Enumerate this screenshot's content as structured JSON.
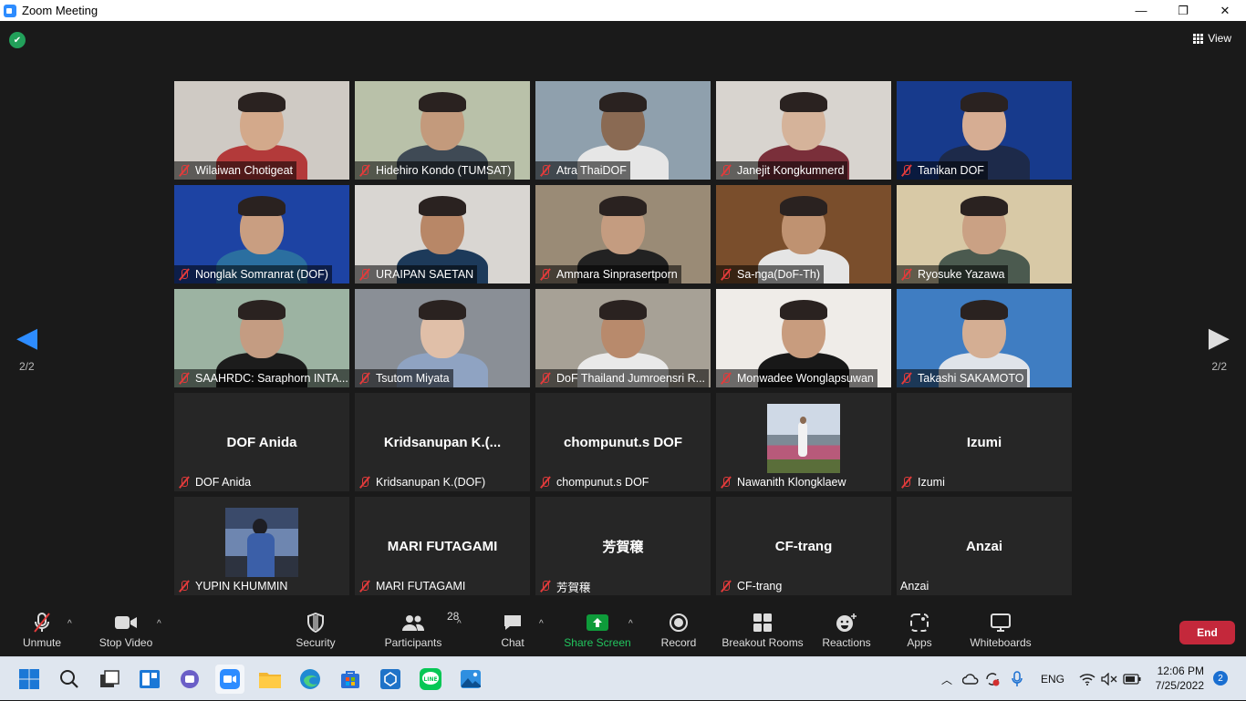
{
  "window": {
    "title": "Zoom Meeting",
    "minimize": "—",
    "maximize": "❐",
    "close": "✕"
  },
  "header": {
    "view_label": "View"
  },
  "pagination": {
    "left": "2/2",
    "right": "2/2"
  },
  "tiles": [
    {
      "name": "Wilaiwan Chotigeat",
      "bg": "#cfcac4",
      "skin": "#d3a98b",
      "shirt": "#b33a3a"
    },
    {
      "name": "Hidehiro Kondo (TUMSAT)",
      "bg": "#b9c1a9",
      "skin": "#c39a7c",
      "shirt": "#3f4a55"
    },
    {
      "name": "Atra ThaiDOF",
      "bg": "#8fa0ad",
      "skin": "#8a6a53",
      "shirt": "#e6e6e6"
    },
    {
      "name": "Janejit Kongkumnerd",
      "bg": "#d8d4cf",
      "skin": "#d5b39a",
      "shirt": "#7a2f3a"
    },
    {
      "name": "Tanikan DOF",
      "bg": "#173a8c",
      "skin": "#d6ad93",
      "shirt": "#1d2a4a"
    },
    {
      "name": "Nonglak Somranrat (DOF)",
      "bg": "#1d43a3",
      "skin": "#c99e81",
      "shirt": "#2b6fa0"
    },
    {
      "name": "URAIPAN SAETAN",
      "bg": "#d9d6d2",
      "skin": "#b88767",
      "shirt": "#1d3a5a"
    },
    {
      "name": "Ammara Sinprasertporn",
      "bg": "#9a8b76",
      "skin": "#c49c80",
      "shirt": "#222"
    },
    {
      "name": "Sa-nga(DoF-Th)",
      "bg": "#7a4e2c",
      "skin": "#bf9271",
      "shirt": "#e5e5e5"
    },
    {
      "name": "Ryosuke Yazawa",
      "bg": "#d8c9a6",
      "skin": "#caa184",
      "shirt": "#4b5a4f"
    },
    {
      "name": "SAAHRDC: Saraphorn INTA...",
      "bg": "#9cb3a2",
      "skin": "#c49c82",
      "shirt": "#1c1c1c"
    },
    {
      "name": "Tsutom Miyata",
      "bg": "#8a8f96",
      "skin": "#e0bfa8",
      "shirt": "#8fa3c2"
    },
    {
      "name": "DoF Thailand Jumroensri R...",
      "bg": "#a7a196",
      "skin": "#b88a6c",
      "shirt": "#e9e9e9"
    },
    {
      "name": "Monwadee Wonglapsuwan",
      "bg": "#efece8",
      "skin": "#c89c7e",
      "shirt": "#181818"
    },
    {
      "name": "Takashi SAKAMOTO",
      "bg": "#3f7dc2",
      "skin": "#d4ae93",
      "shirt": "#e0e4ea"
    }
  ],
  "blank_tiles": [
    {
      "display": "DOF Anida",
      "name": "DOF Anida",
      "muted": true
    },
    {
      "display": "Kridsanupan  K.(...",
      "name": "Kridsanupan K.(DOF)",
      "muted": true
    },
    {
      "display": "chompunut.s DOF",
      "name": "chompunut.s DOF",
      "muted": true
    },
    {
      "display": "",
      "name": "Nawanith Klongklaew",
      "muted": true,
      "photo": "flower"
    },
    {
      "display": "Izumi",
      "name": "Izumi",
      "muted": true
    },
    {
      "display": "",
      "name": "YUPIN KHUMMIN",
      "muted": true,
      "photo": "window"
    },
    {
      "display": "MARI FUTAGAMI",
      "name": "MARI FUTAGAMI",
      "muted": true
    },
    {
      "display": "芳賀穣",
      "name": "芳賀穣",
      "muted": true
    },
    {
      "display": "CF-trang",
      "name": "CF-trang",
      "muted": true
    },
    {
      "display": "Anzai",
      "name": "Anzai",
      "muted": false
    }
  ],
  "toolbar": {
    "unmute": "Unmute",
    "stop_video": "Stop Video",
    "security": "Security",
    "participants": "Participants",
    "participants_count": "28",
    "chat": "Chat",
    "share_screen": "Share Screen",
    "record": "Record",
    "breakout_rooms": "Breakout Rooms",
    "reactions": "Reactions",
    "apps": "Apps",
    "whiteboards": "Whiteboards",
    "end": "End"
  },
  "taskbar": {
    "lang": "ENG",
    "time": "12:06 PM",
    "date": "7/25/2022",
    "notifications": "2"
  },
  "colors": {
    "accent": "#2d8cff",
    "share_green": "#0e9b3a",
    "end_red": "#c4283b",
    "mute_red": "#e23b3b"
  }
}
